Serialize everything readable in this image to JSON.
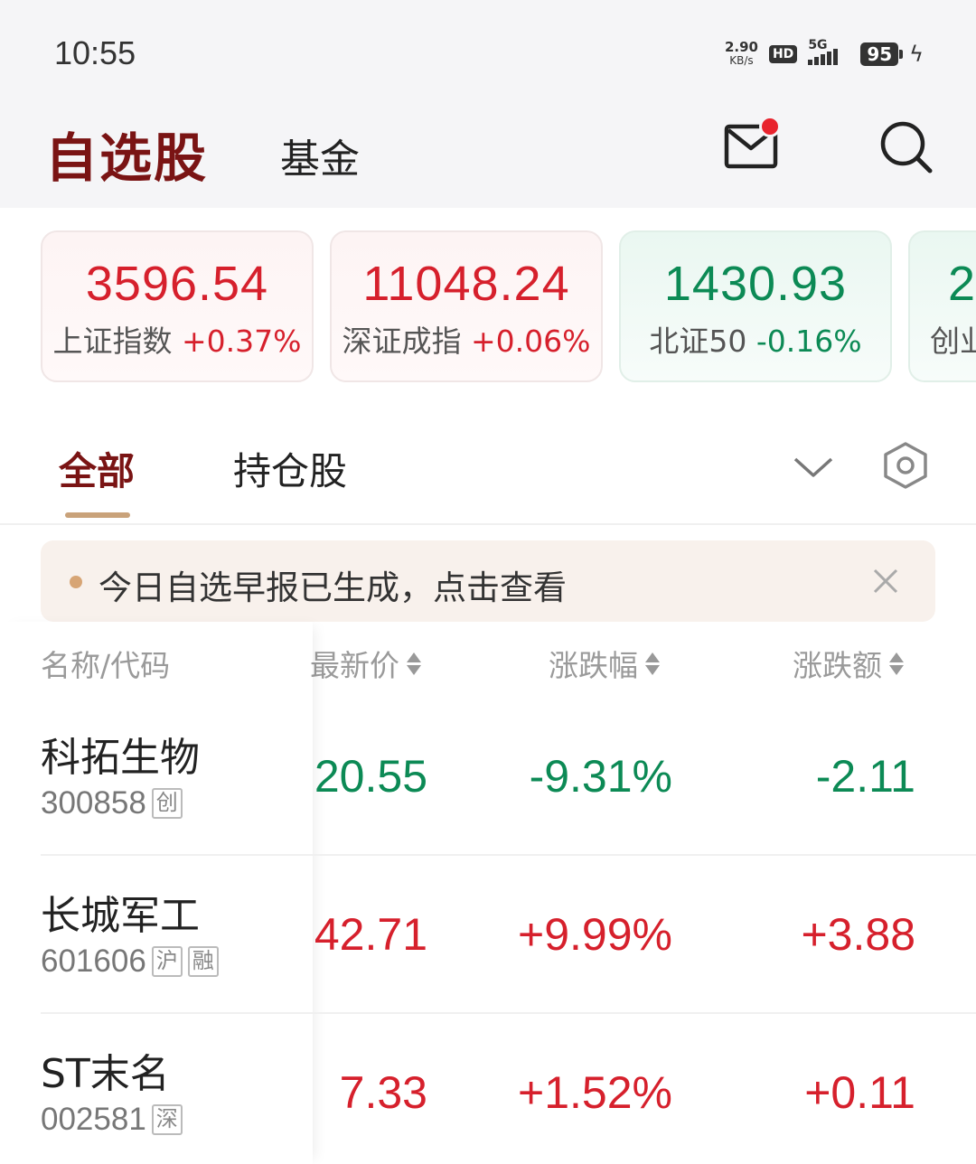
{
  "status_bar": {
    "time": "10:55",
    "net_speed_value": "2.90",
    "net_speed_unit": "KB/s",
    "hd_label": "HD",
    "network_label": "5G",
    "battery_level": "95",
    "icons": [
      "signal-icon",
      "battery-icon",
      "charging-bolt-icon"
    ]
  },
  "header": {
    "title": "自选股",
    "fund_tab": "基金",
    "icons": [
      "mail-icon",
      "search-icon"
    ]
  },
  "indices": [
    {
      "value": "3596.54",
      "name": "上证指数",
      "change": "+0.37%",
      "color": "#d6202c"
    },
    {
      "value": "11048.24",
      "name": "深证成指",
      "change": "+0.06%",
      "color": "#d6202c"
    },
    {
      "value": "1430.93",
      "name": "北证50",
      "change": "-0.16%",
      "color": "#0c8a55"
    },
    {
      "value": "2",
      "name": "创业",
      "change": "",
      "color": "#0c8a55"
    }
  ],
  "tabs": {
    "all": "全部",
    "holdings": "持仓股",
    "icons": [
      "chevron-down-icon",
      "settings-hexagon-icon"
    ]
  },
  "notice": {
    "text": "今日自选早报已生成，点击查看",
    "icons": [
      "close-icon"
    ]
  },
  "table": {
    "headers": {
      "name": "名称/代码",
      "price": "最新价",
      "pct": "涨跌幅",
      "chg": "涨跌额"
    },
    "rows": [
      {
        "name": "科拓生物",
        "code": "300858",
        "tags": [
          "创"
        ],
        "price": "20.55",
        "pct": "-9.31%",
        "chg": "-2.11",
        "color": "#0c8a55"
      },
      {
        "name": "长城军工",
        "code": "601606",
        "tags": [
          "沪",
          "融"
        ],
        "price": "42.71",
        "pct": "+9.99%",
        "chg": "+3.88",
        "color": "#d6202c"
      },
      {
        "name": "ST末名",
        "code": "002581",
        "tags": [
          "深"
        ],
        "price": "7.33",
        "pct": "+1.52%",
        "chg": "+0.11",
        "color": "#d6202c"
      }
    ]
  },
  "colors": {
    "brand": "#7a1414",
    "up": "#d6202c",
    "down": "#0c8a55",
    "accent": "#c9a27a"
  }
}
